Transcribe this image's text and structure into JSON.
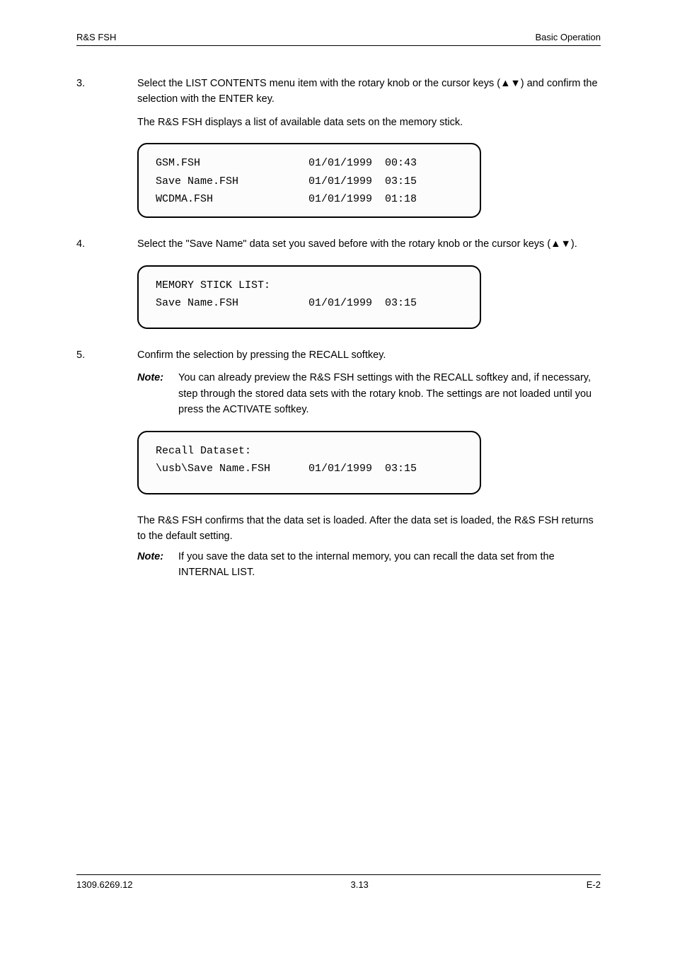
{
  "header": {
    "left": "R&S FSH",
    "right": "Basic Operation"
  },
  "steps": {
    "s3_num": "3.      ",
    "s3_text": "Select the LIST CONTENTS menu item with the rotary knob or the cursor keys (",
    "s3_tri": "▲▼",
    "s3_text2": ") and confirm the selection with the ENTER key.",
    "s3_sub": "The R&S FSH displays a list of available data sets on the memory stick.",
    "s4_num": "4.      ",
    "s4_text": "Select the \"Save Name\" data set you saved before with the rotary knob or the cursor keys (",
    "s4_tri": "▲▼",
    "s4_text2": ").",
    "s5_num": "5.      ",
    "s5_text": "Confirm the selection by pressing the RECALL softkey."
  },
  "screens": {
    "sc1": {
      "line1": "GSM.FSH                 01/01/1999  00:43",
      "line2": "Save Name.FSH           01/01/1999  03:15",
      "line3": "WCDMA.FSH               01/01/1999  01:18"
    },
    "sc2": {
      "line1": "MEMORY STICK LIST:",
      "line2": "Save Name.FSH           01/01/1999  03:15"
    },
    "sc3": {
      "line1": "Recall Dataset:",
      "line2": "\\usb\\Save Name.FSH      01/01/1999  03:15"
    }
  },
  "notes": {
    "n1_label": "Note:",
    "n1_text": "You can already preview the R&S FSH settings with the RECALL softkey and, if necessary, step through the stored data sets with the rotary knob. The settings are not loaded until you press the ACTIVATE softkey.",
    "n2_text": "The R&S FSH confirms that the data set is loaded. After the data set is loaded, the R&S FSH returns to the default setting.",
    "n2_label": "Note:",
    "n2_text2": "If you save the data set to the internal memory, you can recall the data set from the INTERNAL LIST."
  },
  "footer": {
    "left": "1309.6269.12",
    "center": "3.13",
    "right": "E-2"
  }
}
